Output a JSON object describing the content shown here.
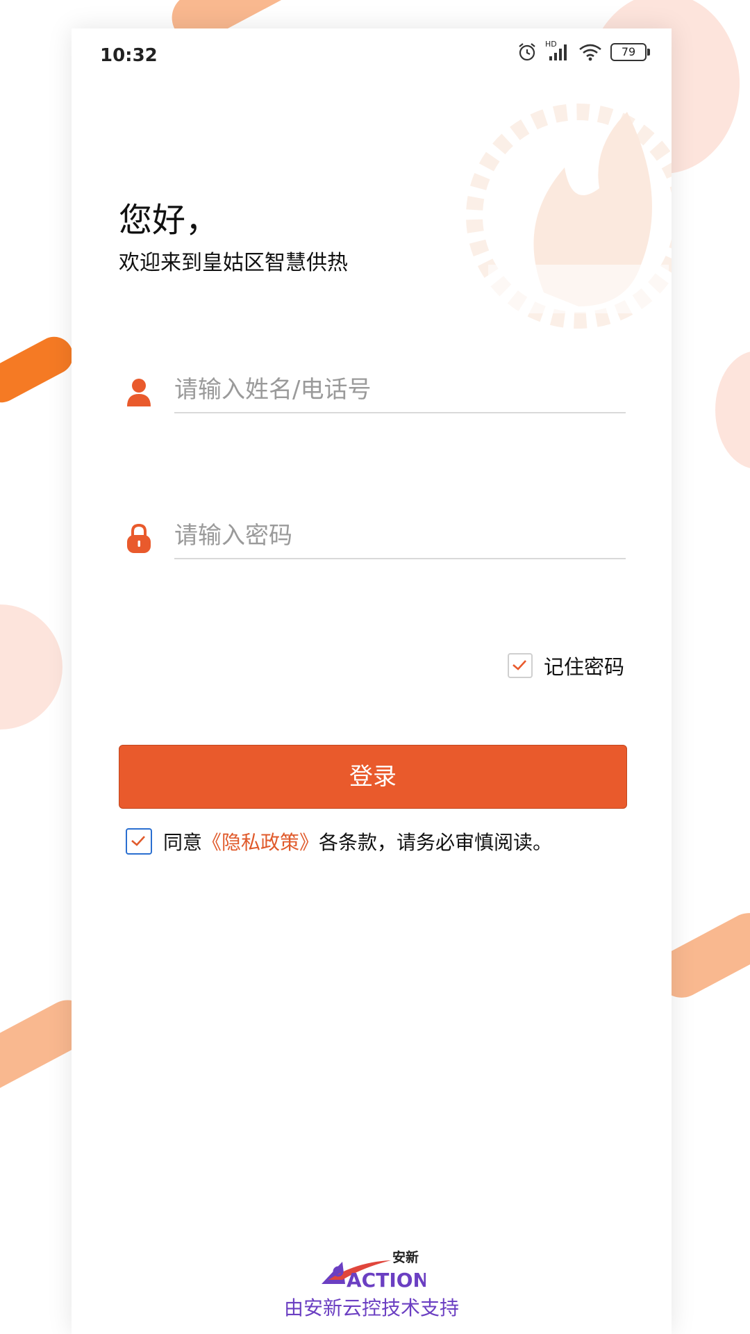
{
  "status_bar": {
    "time": "10:32",
    "network_badge": "HD",
    "battery_level": "79",
    "icons": [
      "alarm-icon",
      "signal-icon",
      "wifi-icon",
      "battery-icon"
    ]
  },
  "greeting": {
    "hello": "您好，",
    "welcome": "欢迎来到皇姑区智慧供热"
  },
  "login_form": {
    "username": {
      "placeholder": "请输入姓名/电话号",
      "value": "",
      "icon": "user-icon"
    },
    "password": {
      "placeholder": "请输入密码",
      "value": "",
      "icon": "lock-icon"
    },
    "remember_password": {
      "label": "记住密码",
      "checked": true
    },
    "submit_label": "登录"
  },
  "agreement": {
    "checked": true,
    "prefix": "同意",
    "policy_link": "《隐私政策》",
    "suffix": "各条款，请务必审慎阅读。"
  },
  "footer": {
    "logo_text_top": "安新",
    "logo_text_main": "ACTION",
    "support_text": "由安新云控技术支持"
  },
  "colors": {
    "accent": "#e95a2c",
    "checkbox_blue": "#2a6fd0",
    "footer_purple": "#6b3fc2"
  }
}
